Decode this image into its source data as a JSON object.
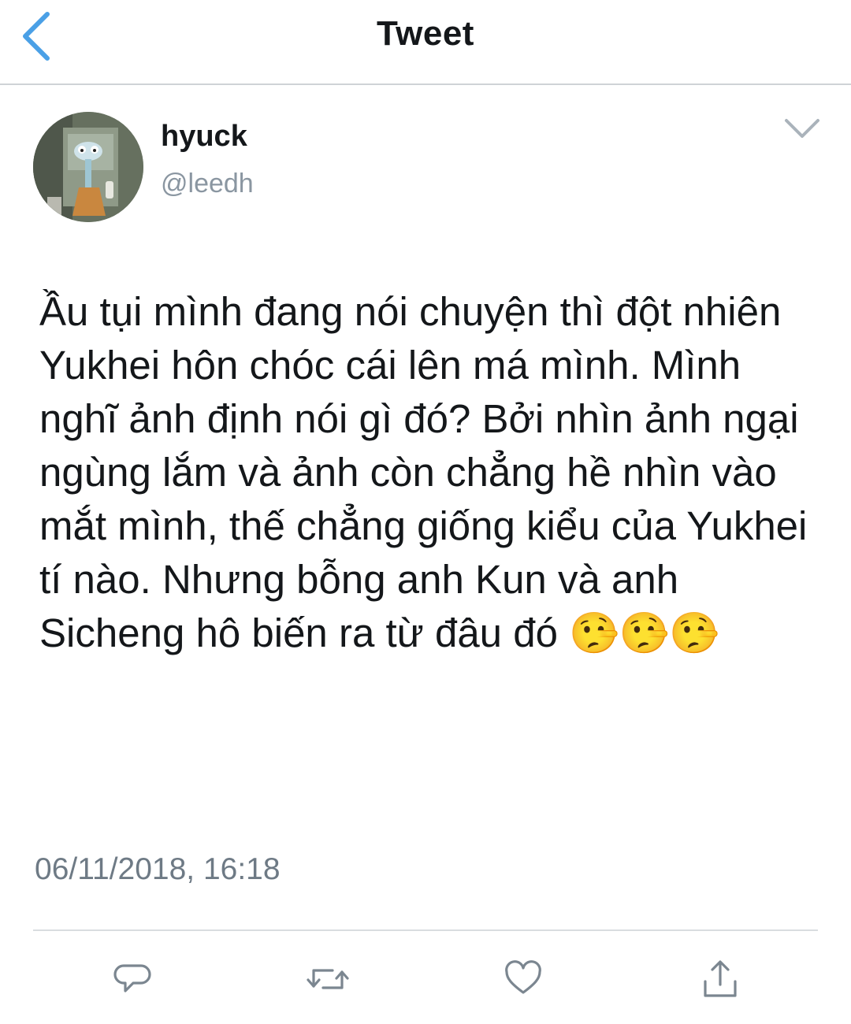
{
  "nav": {
    "title": "Tweet",
    "back_icon": "chevron-left-icon"
  },
  "author": {
    "display_name": "hyuck",
    "handle": "@leedh",
    "more_icon": "chevron-down-icon"
  },
  "tweet": {
    "text": "Ầu tụi mình đang nói chuyện thì đột nhiên Yukhei hôn chóc cái lên má mình. Mình nghĩ ảnh định nói gì đó? Bởi nhìn ảnh ngại ngùng lắm và ảnh còn chẳng hề nhìn vào mắt mình, thế chẳng giống kiểu của Yukhei tí nào. Nhưng bỗng anh Kun và anh Sicheng hô biến ra từ đâu đó 🤥🤥🤥",
    "timestamp": "06/11/2018, 16:18"
  },
  "actions": [
    {
      "name": "reply",
      "icon": "reply-icon"
    },
    {
      "name": "retweet",
      "icon": "retweet-icon"
    },
    {
      "name": "like",
      "icon": "heart-icon"
    },
    {
      "name": "share",
      "icon": "share-icon"
    }
  ],
  "colors": {
    "accent": "#4aa0e6",
    "icon_gray": "#7b8690",
    "muted_text": "#6e7a85"
  }
}
